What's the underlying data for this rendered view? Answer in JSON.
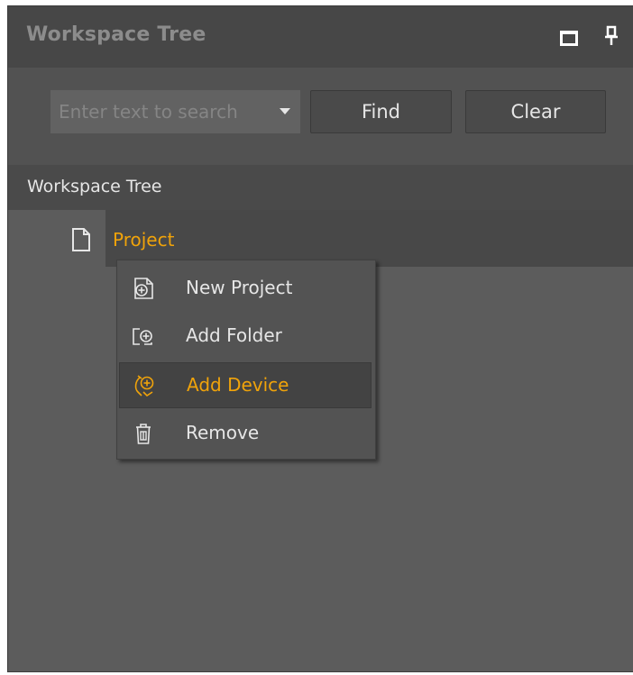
{
  "panel": {
    "title": "Workspace Tree",
    "restore_icon": "restore-window-icon",
    "pin_icon": "pin-icon"
  },
  "search": {
    "placeholder": "Enter text to search",
    "value": "",
    "dropdown_icon": "chevron-down-icon"
  },
  "buttons": {
    "find": "Find",
    "clear": "Clear"
  },
  "tree": {
    "header": "Workspace Tree",
    "root": {
      "label": "Project",
      "icon": "file-icon",
      "selected": true
    }
  },
  "context_menu": {
    "items": [
      {
        "label": "New Project",
        "icon": "new-project-icon",
        "active": false
      },
      {
        "label": "Add Folder",
        "icon": "add-folder-icon",
        "active": false
      },
      {
        "label": "Add Device",
        "icon": "add-device-icon",
        "active": true
      },
      {
        "label": "Remove",
        "icon": "trash-icon",
        "active": false
      }
    ]
  },
  "colors": {
    "accent": "#f0a30a",
    "panel_bg": "#5c5c5c",
    "title_bg": "#474747",
    "text": "#e6e6e6"
  }
}
